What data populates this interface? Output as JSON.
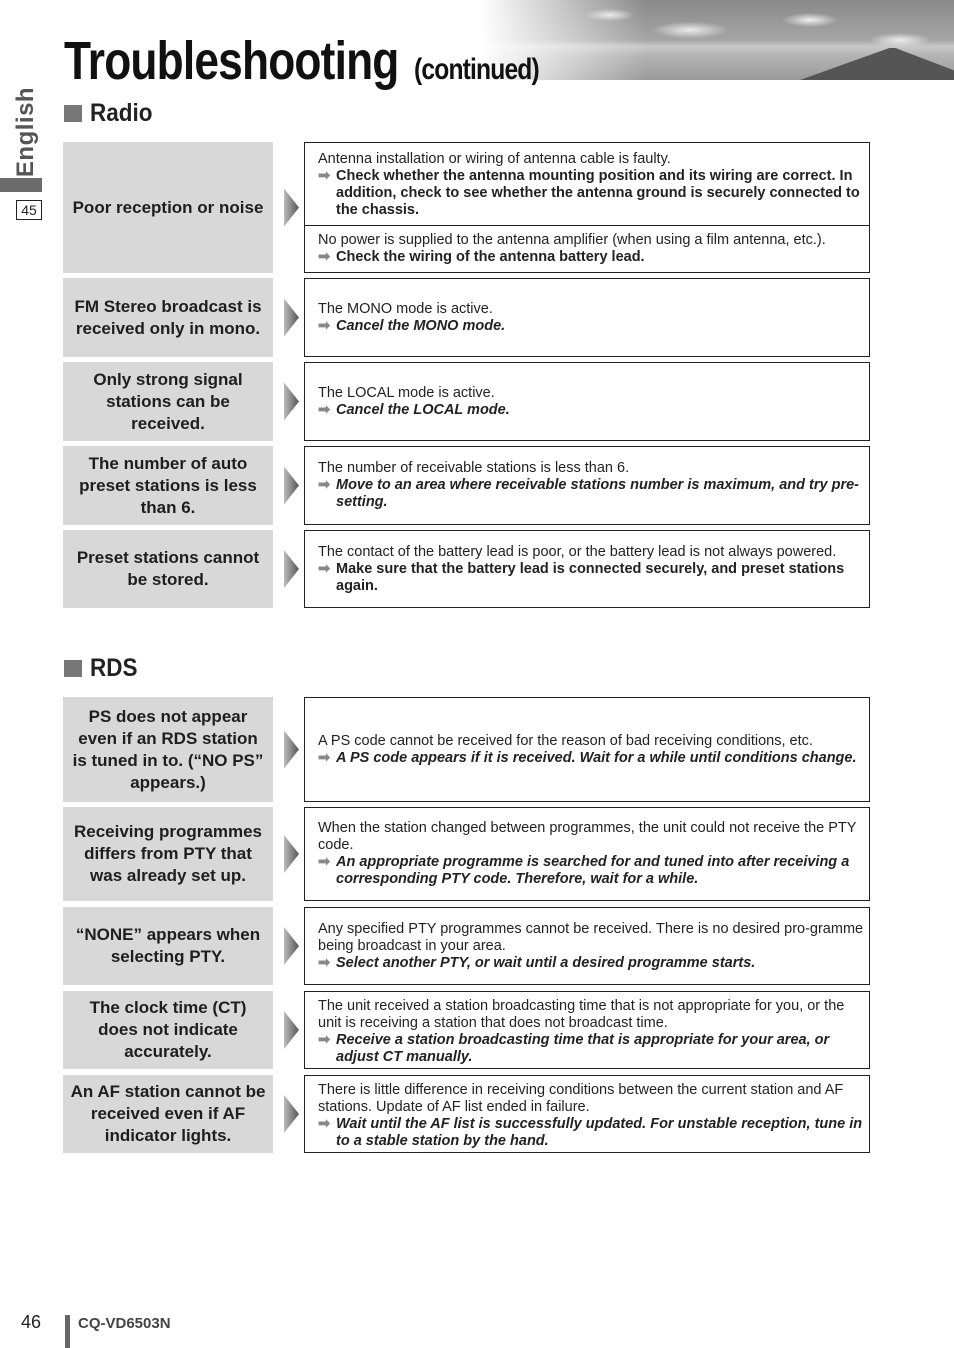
{
  "header": {
    "title": "Troubleshooting",
    "subtitle": "(continued)",
    "side_language": "English",
    "side_page_ref": "45"
  },
  "icons": {
    "arrow_glyph": "➡",
    "section_marker": "square-bullet-icon",
    "problem_pointer": "triangle-pointer-icon"
  },
  "sections": {
    "radio": {
      "heading": "Radio",
      "rows": [
        {
          "problem": "Poor reception or noise",
          "solutions": [
            {
              "cause": "Antenna installation or wiring of antenna cable is faulty.",
              "remedy": "Check whether the antenna mounting position and its wiring are correct. In addition, check to see whether the antenna ground is securely connected to the chassis.",
              "italic": false
            },
            {
              "cause": "No power is supplied to the antenna amplifier (when using a film antenna, etc.).",
              "remedy": "Check the wiring of the antenna battery lead.",
              "italic": false
            }
          ]
        },
        {
          "problem": "FM Stereo broadcast is received only in mono.",
          "solutions": [
            {
              "cause": "The MONO mode is active.",
              "remedy": "Cancel the MONO mode.",
              "italic": true
            }
          ]
        },
        {
          "problem": "Only strong signal stations can be received.",
          "solutions": [
            {
              "cause": "The LOCAL mode is active.",
              "remedy": "Cancel the LOCAL mode.",
              "italic": true
            }
          ]
        },
        {
          "problem": "The number of auto preset stations is less than 6.",
          "solutions": [
            {
              "cause": "The number of receivable stations is less than 6.",
              "remedy": "Move to an area where receivable stations number is maximum, and try pre-setting.",
              "italic": true
            }
          ]
        },
        {
          "problem": "Preset stations cannot be stored.",
          "solutions": [
            {
              "cause": "The contact of the battery lead is poor, or the battery lead is not always powered.",
              "remedy": "Make sure that the battery lead is connected securely, and preset stations again.",
              "italic": false
            }
          ]
        }
      ]
    },
    "rds": {
      "heading": "RDS",
      "rows": [
        {
          "problem": "PS does not appear even if an RDS station is tuned in to. (“NO PS” appears.)",
          "solutions": [
            {
              "cause": "A PS code cannot be received for the reason of bad receiving conditions, etc.",
              "remedy": "A PS code appears if it is received. Wait for a while until conditions change.",
              "italic": true
            }
          ]
        },
        {
          "problem": "Receiving programmes differs from PTY that was already set up.",
          "solutions": [
            {
              "cause": "When the station changed between programmes, the unit could not receive the PTY code.",
              "remedy": "An appropriate programme is searched for and tuned into after receiving a corresponding PTY code. Therefore, wait for a while.",
              "italic": true
            }
          ]
        },
        {
          "problem": "“NONE” appears when selecting PTY.",
          "solutions": [
            {
              "cause": "Any specified PTY programmes cannot be received. There is no desired pro-gramme being broadcast in your area.",
              "remedy": "Select another PTY, or wait until a desired programme starts.",
              "italic": true
            }
          ]
        },
        {
          "problem": "The clock time (CT) does not indicate accurately.",
          "solutions": [
            {
              "cause": "The unit received a station broadcasting time that is not appropriate for you, or the unit is receiving a station that does not broadcast time.",
              "remedy": "Receive a station broadcasting time that is appropriate for your area, or adjust CT manually.",
              "italic": true
            }
          ]
        },
        {
          "problem": "An AF station cannot be received even if AF indicator lights.",
          "solutions": [
            {
              "cause": "There is little difference in receiving conditions between the current station and AF stations. Update of AF list ended in failure.",
              "remedy": "Wait until the AF list is successfully updated. For unstable reception, tune in to a stable station by the hand.",
              "italic": true
            }
          ]
        }
      ]
    }
  },
  "footer": {
    "page_number": "46",
    "model": "CQ-VD6503N"
  }
}
